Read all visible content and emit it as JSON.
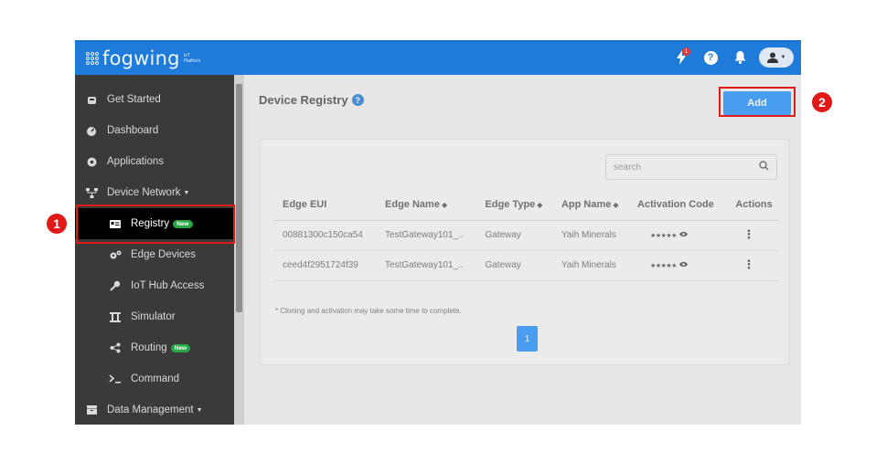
{
  "header": {
    "logo_text": "fogwing",
    "logo_sub": "IoT Platform",
    "notification_count": "1"
  },
  "sidebar": {
    "items": [
      {
        "label": "Get Started"
      },
      {
        "label": "Dashboard"
      },
      {
        "label": "Applications"
      },
      {
        "label": "Device Network"
      },
      {
        "label": "Registry",
        "badge": "New"
      },
      {
        "label": "Edge Devices"
      },
      {
        "label": "IoT Hub Access"
      },
      {
        "label": "Simulator"
      },
      {
        "label": "Routing",
        "badge": "New"
      },
      {
        "label": "Command"
      },
      {
        "label": "Data Management"
      }
    ]
  },
  "main": {
    "title": "Device Registry",
    "add_label": "Add",
    "search_placeholder": "search",
    "columns": [
      "Edge EUI",
      "Edge Name",
      "Edge Type",
      "App Name",
      "Activation Code",
      "Actions"
    ],
    "rows": [
      {
        "eui": "00881300c150ca54",
        "name": "TestGateway101_..",
        "type": "Gateway",
        "app": "Yaih Minerals",
        "code": "★★★★★"
      },
      {
        "eui": "ceed4f2951724f39",
        "name": "TestGateway101_..",
        "type": "Gateway",
        "app": "Yaih Minerals",
        "code": "★★★★★"
      }
    ],
    "note": "* Cloning and activation may take some time to complete.",
    "page": "1"
  },
  "annotations": {
    "marker_1": "1",
    "marker_2": "2"
  },
  "colors": {
    "header": "#1f7bd9",
    "sidebar": "#3a3a3a",
    "accent": "#1f8fff",
    "badge_new": "#28a745",
    "annotation": "#e11919"
  }
}
